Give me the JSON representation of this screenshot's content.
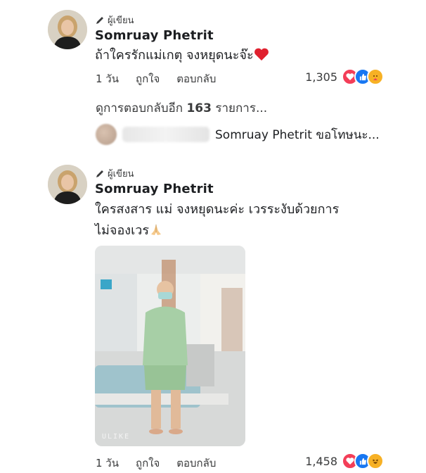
{
  "comments": [
    {
      "author_badge": "ผู้เขียน",
      "author": "Somruay Phetrit",
      "text": "ถ้าใครรักแม่เกตุ จงหยุดนะจ๊ะ",
      "time": "1 วัน",
      "like": "ถูกใจ",
      "reply": "ตอบกลับ",
      "reaction_count": "1,305",
      "reactions": [
        "love-icon",
        "like-icon",
        "care-icon"
      ],
      "view_replies_prefix": "ดูการตอบกลับอีก",
      "view_replies_count": "163",
      "view_replies_suffix": "รายการ...",
      "reply_preview": "Somruay Phetrit ขอโทษนะ..."
    },
    {
      "author_badge": "ผู้เขียน",
      "author": "Somruay Phetrit",
      "text_line1": "ใครสงสาร แม่ จงหยุดนะค่ะ เวรระงับด้วยการ",
      "text_line2": "ไม่จองเวร",
      "photo_watermark": "ULIKE",
      "time": "1 วัน",
      "like": "ถูกใจ",
      "reply": "ตอบกลับ",
      "reaction_count": "1,458",
      "reactions": [
        "love-icon",
        "like-icon",
        "haha-icon"
      ]
    }
  ],
  "colors": {
    "love": "#f33e58",
    "like": "#1877f2",
    "care": "#f7b125"
  }
}
